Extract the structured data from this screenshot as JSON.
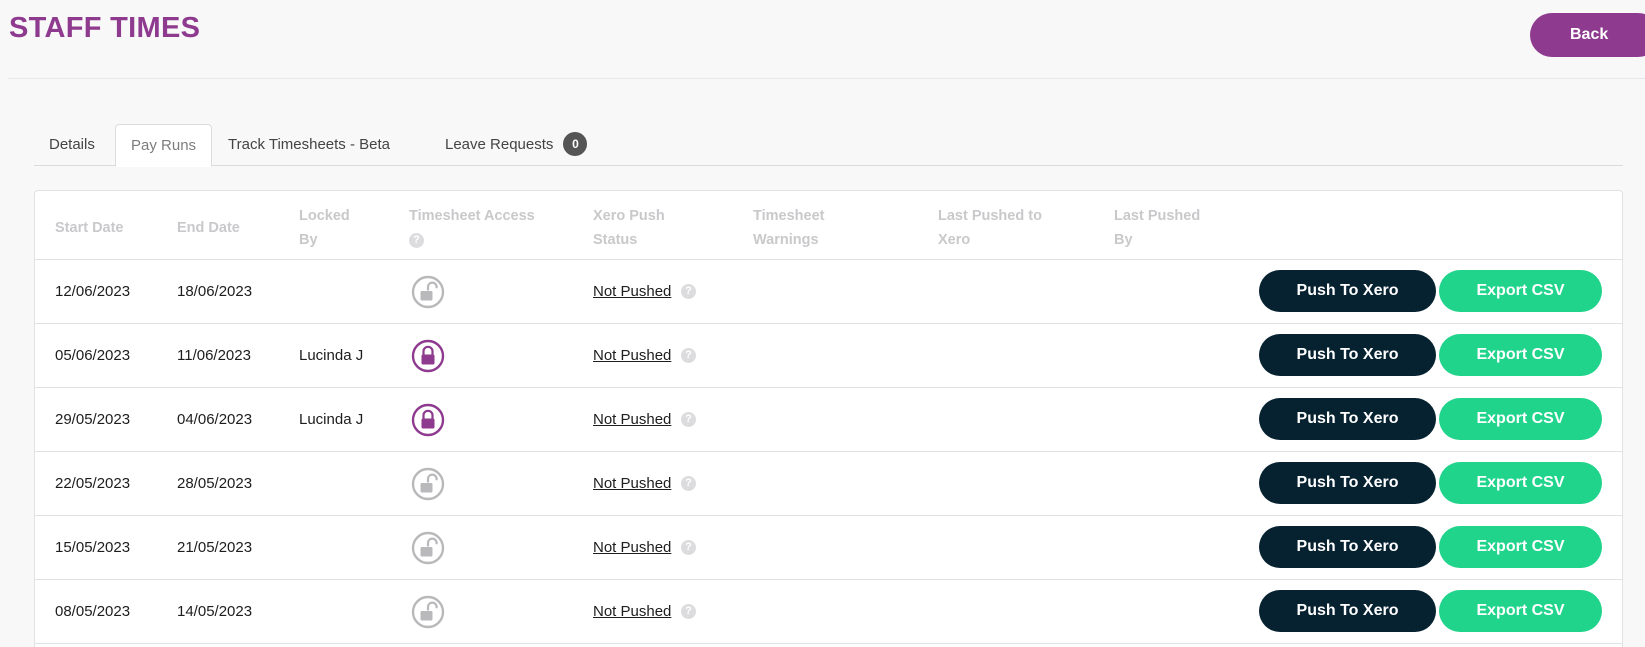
{
  "header": {
    "title": "STAFF TIMES",
    "back_label": "Back"
  },
  "tabs": [
    {
      "label": "Details",
      "active": false
    },
    {
      "label": "Pay Runs",
      "active": true
    },
    {
      "label": "Track Timesheets - Beta",
      "active": false
    },
    {
      "label": "Leave Requests",
      "active": false,
      "badge": "0"
    }
  ],
  "table": {
    "columns": {
      "start_date": "Start Date",
      "end_date": "End Date",
      "locked_by_1": "Locked",
      "locked_by_2": "By",
      "timesheet_access": "Timesheet Access",
      "help_glyph": "?",
      "xero_push_status_1": "Xero Push",
      "xero_push_status_2": "Status",
      "timesheet_warnings_1": "Timesheet",
      "timesheet_warnings_2": "Warnings",
      "last_pushed_to_1": "Last Pushed to",
      "last_pushed_to_2": "Xero",
      "last_pushed_by_1": "Last Pushed",
      "last_pushed_by_2": "By"
    },
    "rows": [
      {
        "start": "12/06/2023",
        "end": "18/06/2023",
        "locked_by": "",
        "locked": false,
        "status": "Not Pushed",
        "push": "Push To Xero",
        "export": "Export CSV"
      },
      {
        "start": "05/06/2023",
        "end": "11/06/2023",
        "locked_by": "Lucinda J",
        "locked": true,
        "status": "Not Pushed",
        "push": "Push To Xero",
        "export": "Export CSV"
      },
      {
        "start": "29/05/2023",
        "end": "04/06/2023",
        "locked_by": "Lucinda J",
        "locked": true,
        "status": "Not Pushed",
        "push": "Push To Xero",
        "export": "Export CSV"
      },
      {
        "start": "22/05/2023",
        "end": "28/05/2023",
        "locked_by": "",
        "locked": false,
        "status": "Not Pushed",
        "push": "Push To Xero",
        "export": "Export CSV"
      },
      {
        "start": "15/05/2023",
        "end": "21/05/2023",
        "locked_by": "",
        "locked": false,
        "status": "Not Pushed",
        "push": "Push To Xero",
        "export": "Export CSV"
      },
      {
        "start": "08/05/2023",
        "end": "14/05/2023",
        "locked_by": "",
        "locked": false,
        "status": "Not Pushed",
        "push": "Push To Xero",
        "export": "Export CSV"
      }
    ]
  },
  "colors": {
    "brand": "#8e3a8e",
    "push_button": "#06212f",
    "export_button": "#21d48c",
    "lock_unlocked": "#b9b9bc"
  },
  "icons": {
    "locked": "lock-icon",
    "unlocked": "unlock-icon",
    "help": "help-icon"
  }
}
